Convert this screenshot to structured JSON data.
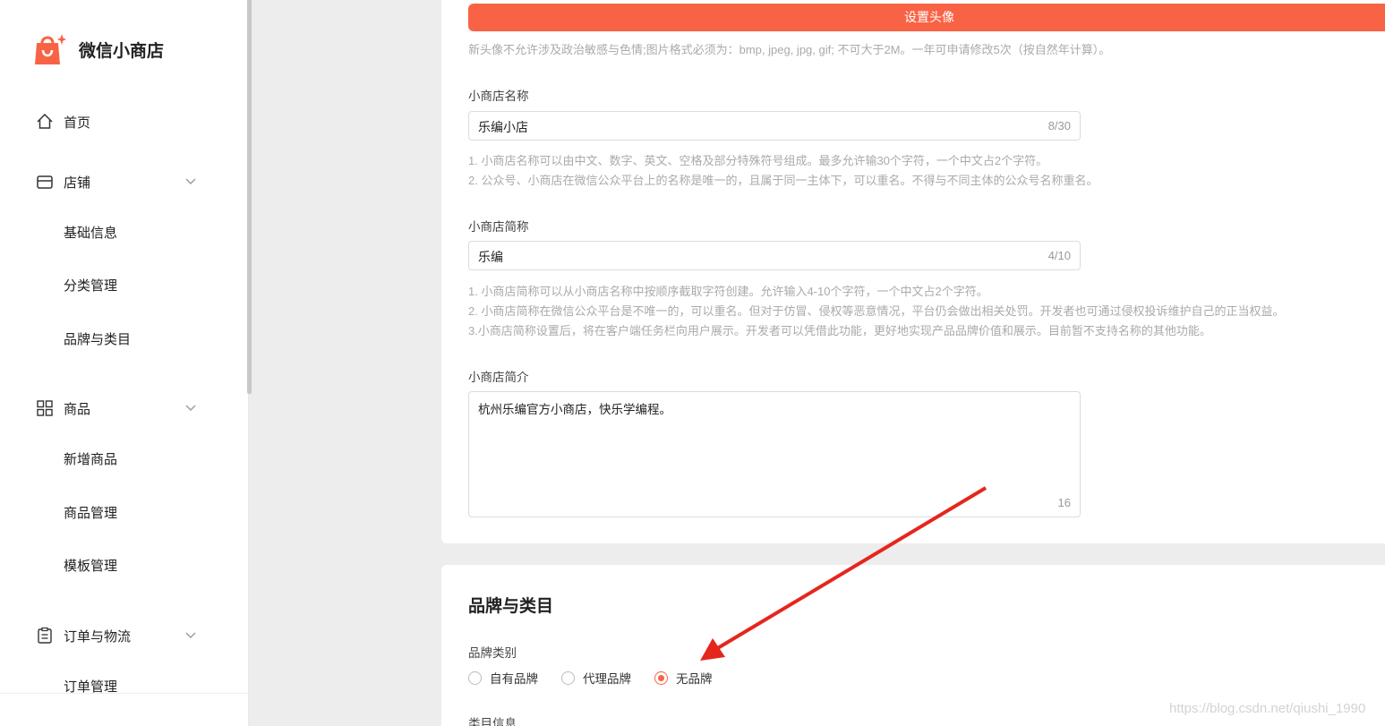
{
  "sidebar": {
    "logo_text": "微信小商店",
    "home": "首页",
    "shop": "店铺",
    "shop_items": [
      "基础信息",
      "分类管理",
      "品牌与类目"
    ],
    "goods": "商品",
    "goods_items": [
      "新增商品",
      "商品管理",
      "模板管理"
    ],
    "orders": "订单与物流",
    "order_items": [
      "订单管理"
    ]
  },
  "avatar": {
    "button_label": "设置头像",
    "hint": "新头像不允许涉及政治敏感与色情;图片格式必须为：bmp, jpeg, jpg, gif; 不可大于2M。一年可申请修改5次（按自然年计算）。"
  },
  "shop_name": {
    "label": "小商店名称",
    "value": "乐编小店",
    "count": "8/30",
    "hints": [
      "1. 小商店名称可以由中文、数字、英文、空格及部分特殊符号组成。最多允许输30个字符，一个中文占2个字符。",
      "2. 公众号、小商店在微信公众平台上的名称是唯一的，且属于同一主体下，可以重名。不得与不同主体的公众号名称重名。"
    ]
  },
  "short_name": {
    "label": "小商店简称",
    "value": "乐编",
    "count": "4/10",
    "hints": [
      "1. 小商店简称可以从小商店名称中按顺序截取字符创建。允许输入4-10个字符，一个中文占2个字符。",
      "2. 小商店简称在微信公众平台是不唯一的，可以重名。但对于仿冒、侵权等恶意情况，平台仍会做出相关处罚。开发者也可通过侵权投诉维护自己的正当权益。",
      "3.小商店简称设置后，将在客户端任务栏向用户展示。开发者可以凭借此功能，更好地实现产品品牌价值和展示。目前暂不支持名称的其他功能。"
    ]
  },
  "intro": {
    "label": "小商店简介",
    "value": "杭州乐编官方小商店，快乐学编程。",
    "count": "16"
  },
  "brand": {
    "section_title": "品牌与类目",
    "type_label": "品牌类别",
    "options": [
      "自有品牌",
      "代理品牌",
      "无品牌"
    ],
    "selected": "无品牌",
    "category_label": "类目信息"
  },
  "colors": {
    "accent": "#f96345",
    "arrow": "#e5261d"
  },
  "watermark": "https://blog.csdn.net/qiushi_1990"
}
